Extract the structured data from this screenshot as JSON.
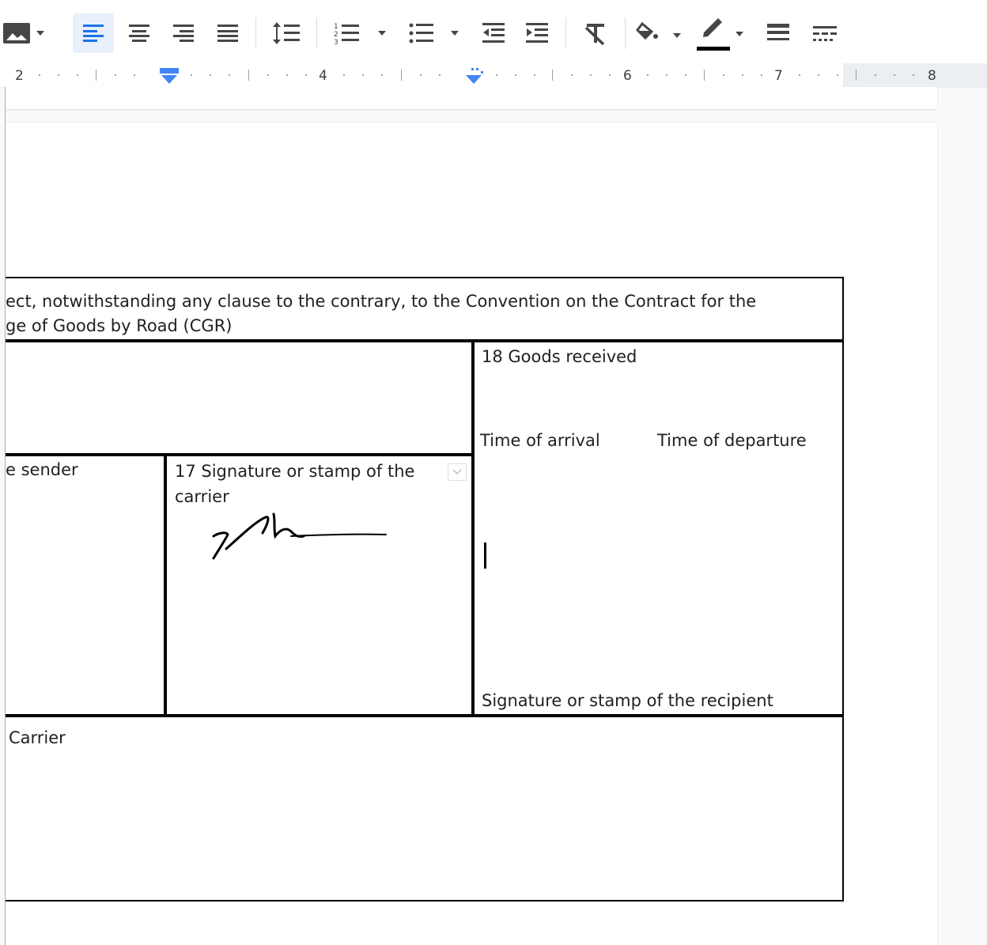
{
  "toolbar": {
    "buttons": [
      {
        "name": "insert-image-button",
        "icon": "image-icon"
      },
      {
        "name": "align-left-button",
        "icon": "align-left-icon",
        "active": true
      },
      {
        "name": "align-center-button",
        "icon": "align-center-icon"
      },
      {
        "name": "align-right-button",
        "icon": "align-right-icon"
      },
      {
        "name": "align-justify-button",
        "icon": "align-justify-icon"
      },
      {
        "name": "line-spacing-button",
        "icon": "line-spacing-icon"
      },
      {
        "name": "numbered-list-button",
        "icon": "numbered-list-icon"
      },
      {
        "name": "bulleted-list-button",
        "icon": "bulleted-list-icon"
      },
      {
        "name": "decrease-indent-button",
        "icon": "decrease-indent-icon"
      },
      {
        "name": "increase-indent-button",
        "icon": "increase-indent-icon"
      },
      {
        "name": "clear-formatting-button",
        "icon": "clear-formatting-icon"
      },
      {
        "name": "background-color-button",
        "icon": "paint-bucket-icon"
      },
      {
        "name": "border-color-button",
        "icon": "pen-icon"
      },
      {
        "name": "border-width-button",
        "icon": "border-width-icon"
      },
      {
        "name": "border-dash-button",
        "icon": "border-dash-icon"
      }
    ],
    "accent_color": "#1a73e8",
    "active_bg": "#e8f0fe",
    "border_color_swatch": "#000000"
  },
  "ruler": {
    "numbers": [
      "2",
      "4",
      "6",
      "7",
      "8"
    ]
  },
  "document": {
    "clause_line1": "ect, notwithstanding any clause to the contrary, to the Convention on the Contract for the",
    "clause_line2": "ge of Goods by Road (CGR)",
    "goods_received": "18 Goods received",
    "time_of_arrival": "Time of arrival",
    "time_of_departure": "Time of departure",
    "sender_label": "e sender",
    "carrier_signature_line1": "17 Signature or stamp of the",
    "carrier_signature_line2": "carrier",
    "recipient_signature": "Signature or stamp of the recipient",
    "carrier_label": "Carrier"
  }
}
